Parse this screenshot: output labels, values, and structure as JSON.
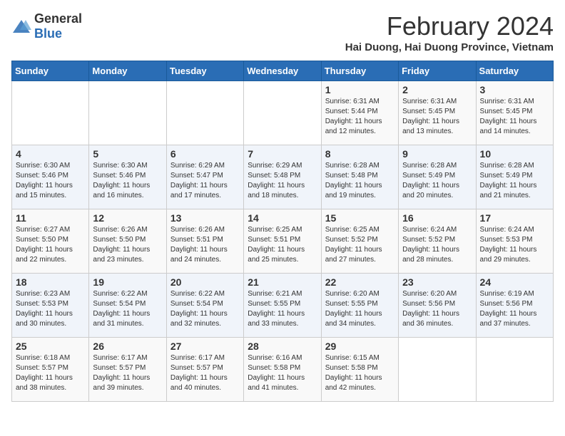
{
  "header": {
    "logo_general": "General",
    "logo_blue": "Blue",
    "title": "February 2024",
    "subtitle": "Hai Duong, Hai Duong Province, Vietnam"
  },
  "days_of_week": [
    "Sunday",
    "Monday",
    "Tuesday",
    "Wednesday",
    "Thursday",
    "Friday",
    "Saturday"
  ],
  "weeks": [
    [
      {
        "day": "",
        "info": ""
      },
      {
        "day": "",
        "info": ""
      },
      {
        "day": "",
        "info": ""
      },
      {
        "day": "",
        "info": ""
      },
      {
        "day": "1",
        "info": "Sunrise: 6:31 AM\nSunset: 5:44 PM\nDaylight: 11 hours and 12 minutes."
      },
      {
        "day": "2",
        "info": "Sunrise: 6:31 AM\nSunset: 5:45 PM\nDaylight: 11 hours and 13 minutes."
      },
      {
        "day": "3",
        "info": "Sunrise: 6:31 AM\nSunset: 5:45 PM\nDaylight: 11 hours and 14 minutes."
      }
    ],
    [
      {
        "day": "4",
        "info": "Sunrise: 6:30 AM\nSunset: 5:46 PM\nDaylight: 11 hours and 15 minutes."
      },
      {
        "day": "5",
        "info": "Sunrise: 6:30 AM\nSunset: 5:46 PM\nDaylight: 11 hours and 16 minutes."
      },
      {
        "day": "6",
        "info": "Sunrise: 6:29 AM\nSunset: 5:47 PM\nDaylight: 11 hours and 17 minutes."
      },
      {
        "day": "7",
        "info": "Sunrise: 6:29 AM\nSunset: 5:48 PM\nDaylight: 11 hours and 18 minutes."
      },
      {
        "day": "8",
        "info": "Sunrise: 6:28 AM\nSunset: 5:48 PM\nDaylight: 11 hours and 19 minutes."
      },
      {
        "day": "9",
        "info": "Sunrise: 6:28 AM\nSunset: 5:49 PM\nDaylight: 11 hours and 20 minutes."
      },
      {
        "day": "10",
        "info": "Sunrise: 6:28 AM\nSunset: 5:49 PM\nDaylight: 11 hours and 21 minutes."
      }
    ],
    [
      {
        "day": "11",
        "info": "Sunrise: 6:27 AM\nSunset: 5:50 PM\nDaylight: 11 hours and 22 minutes."
      },
      {
        "day": "12",
        "info": "Sunrise: 6:26 AM\nSunset: 5:50 PM\nDaylight: 11 hours and 23 minutes."
      },
      {
        "day": "13",
        "info": "Sunrise: 6:26 AM\nSunset: 5:51 PM\nDaylight: 11 hours and 24 minutes."
      },
      {
        "day": "14",
        "info": "Sunrise: 6:25 AM\nSunset: 5:51 PM\nDaylight: 11 hours and 25 minutes."
      },
      {
        "day": "15",
        "info": "Sunrise: 6:25 AM\nSunset: 5:52 PM\nDaylight: 11 hours and 27 minutes."
      },
      {
        "day": "16",
        "info": "Sunrise: 6:24 AM\nSunset: 5:52 PM\nDaylight: 11 hours and 28 minutes."
      },
      {
        "day": "17",
        "info": "Sunrise: 6:24 AM\nSunset: 5:53 PM\nDaylight: 11 hours and 29 minutes."
      }
    ],
    [
      {
        "day": "18",
        "info": "Sunrise: 6:23 AM\nSunset: 5:53 PM\nDaylight: 11 hours and 30 minutes."
      },
      {
        "day": "19",
        "info": "Sunrise: 6:22 AM\nSunset: 5:54 PM\nDaylight: 11 hours and 31 minutes."
      },
      {
        "day": "20",
        "info": "Sunrise: 6:22 AM\nSunset: 5:54 PM\nDaylight: 11 hours and 32 minutes."
      },
      {
        "day": "21",
        "info": "Sunrise: 6:21 AM\nSunset: 5:55 PM\nDaylight: 11 hours and 33 minutes."
      },
      {
        "day": "22",
        "info": "Sunrise: 6:20 AM\nSunset: 5:55 PM\nDaylight: 11 hours and 34 minutes."
      },
      {
        "day": "23",
        "info": "Sunrise: 6:20 AM\nSunset: 5:56 PM\nDaylight: 11 hours and 36 minutes."
      },
      {
        "day": "24",
        "info": "Sunrise: 6:19 AM\nSunset: 5:56 PM\nDaylight: 11 hours and 37 minutes."
      }
    ],
    [
      {
        "day": "25",
        "info": "Sunrise: 6:18 AM\nSunset: 5:57 PM\nDaylight: 11 hours and 38 minutes."
      },
      {
        "day": "26",
        "info": "Sunrise: 6:17 AM\nSunset: 5:57 PM\nDaylight: 11 hours and 39 minutes."
      },
      {
        "day": "27",
        "info": "Sunrise: 6:17 AM\nSunset: 5:57 PM\nDaylight: 11 hours and 40 minutes."
      },
      {
        "day": "28",
        "info": "Sunrise: 6:16 AM\nSunset: 5:58 PM\nDaylight: 11 hours and 41 minutes."
      },
      {
        "day": "29",
        "info": "Sunrise: 6:15 AM\nSunset: 5:58 PM\nDaylight: 11 hours and 42 minutes."
      },
      {
        "day": "",
        "info": ""
      },
      {
        "day": "",
        "info": ""
      }
    ]
  ]
}
